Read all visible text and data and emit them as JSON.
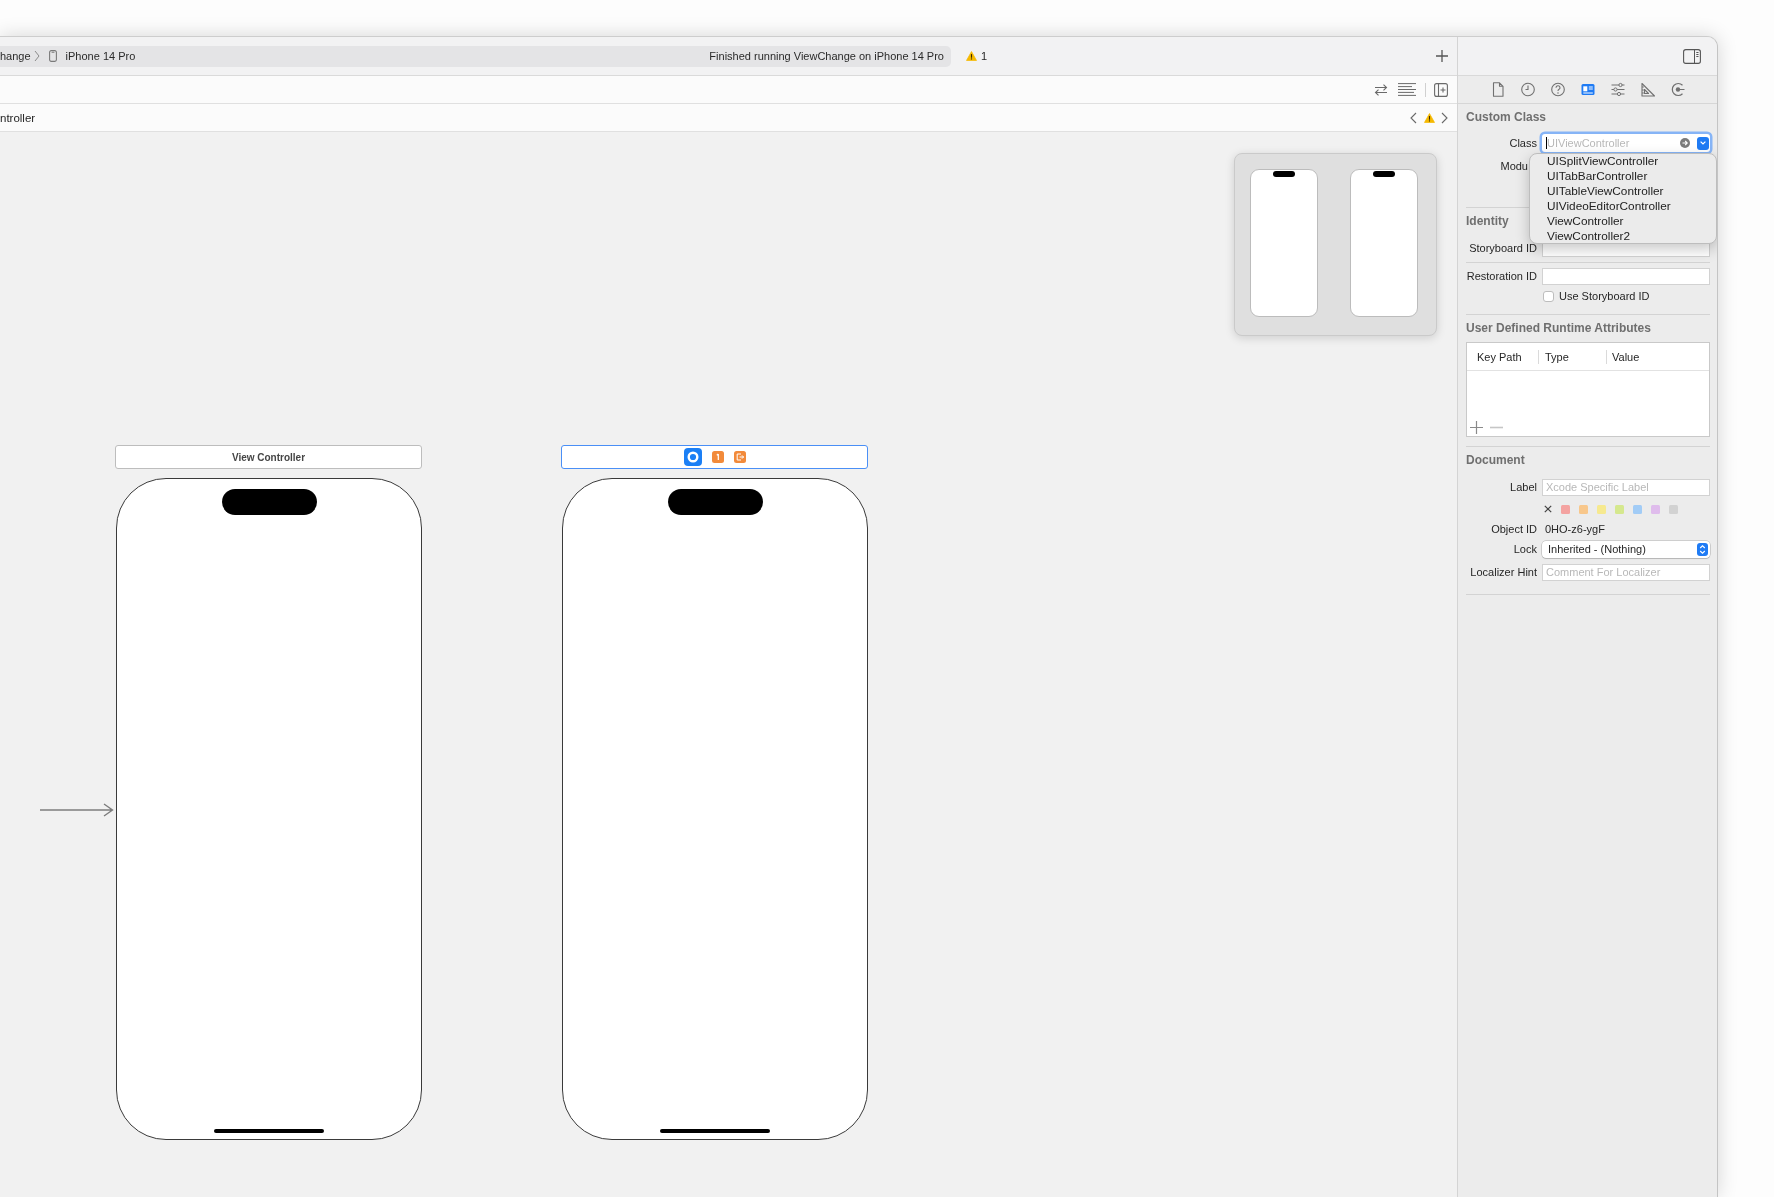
{
  "toolbar": {
    "scheme": "hange",
    "destination": "iPhone 14 Pro",
    "status": "Finished running ViewChange on iPhone 14 Pro",
    "warning_count": "1"
  },
  "jump_bar": {
    "path": "ntroller"
  },
  "canvas": {
    "scenes": [
      {
        "title": "View Controller",
        "selected": false,
        "initial": true
      },
      {
        "selected": true
      }
    ]
  },
  "inspector": {
    "tabs": [
      {
        "kind": "file",
        "selected": false
      },
      {
        "kind": "history",
        "selected": false
      },
      {
        "kind": "help",
        "selected": false
      },
      {
        "kind": "identity",
        "selected": true
      },
      {
        "kind": "attributes",
        "selected": false
      },
      {
        "kind": "size",
        "selected": false
      },
      {
        "kind": "connections",
        "selected": false
      }
    ],
    "custom_class": {
      "title": "Custom Class",
      "class_label": "Class",
      "class_placeholder": "UIViewController",
      "module_label": "Modu",
      "suggestions": [
        {
          "name": "UISplitViewController",
          "selected": false
        },
        {
          "name": "UITabBarController",
          "selected": false
        },
        {
          "name": "UITableViewController",
          "selected": false
        },
        {
          "name": "UIVideoEditorController",
          "selected": false
        },
        {
          "name": "ViewController",
          "selected": false
        },
        {
          "name": "ViewController2",
          "selected": false
        }
      ]
    },
    "identity": {
      "title": "Identity",
      "storyboard_id_label": "Storyboard ID",
      "restoration_id_label": "Restoration ID",
      "use_storyboard_id": {
        "label": "Use Storyboard ID",
        "checked": false
      }
    },
    "runtime_attributes": {
      "title": "User Defined Runtime Attributes",
      "columns": [
        "Key Path",
        "Type",
        "Value"
      ],
      "remove_button": {
        "disabled": true
      }
    },
    "document": {
      "title": "Document",
      "label_label": "Label",
      "label_placeholder": "Xcode Specific Label",
      "label_colors": [
        {
          "color": "#f4a3a1",
          "selected": false
        },
        {
          "color": "#f8c78b",
          "selected": false
        },
        {
          "color": "#f6e98f",
          "selected": false
        },
        {
          "color": "#d5e88e",
          "selected": false
        },
        {
          "color": "#a2ccf6",
          "selected": false
        },
        {
          "color": "#dfbcec",
          "selected": false
        },
        {
          "color": "#d2d2d2",
          "selected": false
        }
      ],
      "object_id_label": "Object ID",
      "object_id": "0HO-z6-ygF",
      "lock_label": "Lock",
      "lock": "Inherited - (Nothing)",
      "localizer_hint_label": "Localizer Hint",
      "localizer_hint_placeholder": "Comment For Localizer"
    }
  }
}
